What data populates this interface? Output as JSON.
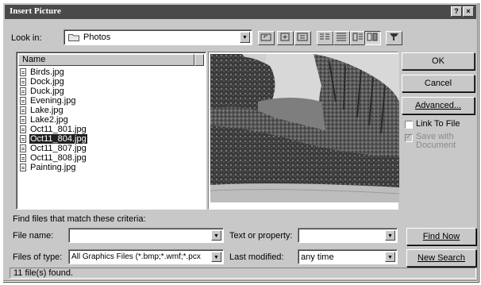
{
  "window": {
    "title": "Insert Picture",
    "help_label": "?",
    "close_label": "×"
  },
  "lookin": {
    "label": "Look in:",
    "value": "Photos"
  },
  "toolbar": {
    "up_icon": "up-one-level-icon",
    "desktop_icon": "look-in-favorites-icon",
    "newfolder_icon": "create-new-folder-icon",
    "list_icon": "list-view-icon",
    "details_icon": "details-view-icon",
    "properties_icon": "properties-view-icon",
    "preview_icon": "preview-view-icon",
    "commands_icon": "commands-and-settings-icon"
  },
  "file_list": {
    "column_header": "Name",
    "files": [
      {
        "name": "Birds.jpg",
        "selected": false
      },
      {
        "name": "Dock.jpg",
        "selected": false
      },
      {
        "name": "Duck.jpg",
        "selected": false
      },
      {
        "name": "Evening.jpg",
        "selected": false
      },
      {
        "name": "Lake.jpg",
        "selected": false
      },
      {
        "name": "Lake2.jpg",
        "selected": false
      },
      {
        "name": "Oct11_801.jpg",
        "selected": false
      },
      {
        "name": "Oct11_804.jpg",
        "selected": true
      },
      {
        "name": "Oct11_807.jpg",
        "selected": false
      },
      {
        "name": "Oct11_808.jpg",
        "selected": false
      },
      {
        "name": "Painting.jpg",
        "selected": false
      }
    ]
  },
  "buttons": {
    "ok": "OK",
    "cancel": "Cancel",
    "advanced": "Advanced...",
    "find_now": "Find Now",
    "new_search": "New Search"
  },
  "checkboxes": {
    "link_to_file": "Link To File",
    "save_with_doc_line1": "Save with",
    "save_with_doc_line2": "Document"
  },
  "search": {
    "criteria_label": "Find files that match these criteria:",
    "file_name_label": "File name:",
    "file_name_value": "",
    "files_of_type_label": "Files of type:",
    "files_of_type_value": "All Graphics Files (*.bmp;*.wmf;*.pcx",
    "text_property_label": "Text or property:",
    "text_property_value": "",
    "last_modified_label": "Last modified:",
    "last_modified_value": "any time"
  },
  "status": {
    "text": "11 file(s) found."
  }
}
